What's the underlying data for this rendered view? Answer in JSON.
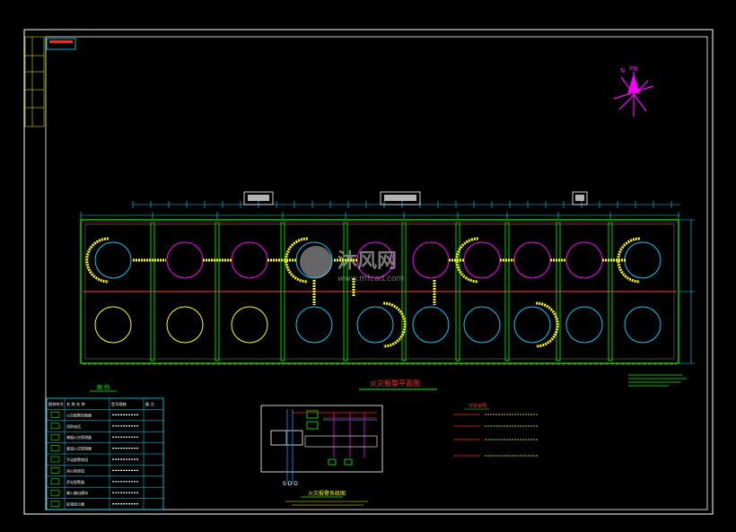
{
  "drawing": {
    "plan_title": "火灾报警平面图",
    "system_title": "火灾报警系统图",
    "system_label_sdd": "S D D",
    "north_label": "N",
    "pn_label": "PN",
    "watermark_cn": "沐风网",
    "watermark_url": "www.mfcad.com"
  },
  "legend": {
    "title": "图 例",
    "headers": [
      "图例符号",
      "名 称 名 称",
      "型号规格",
      "备 注"
    ],
    "rows": [
      {
        "name": "火灾报警控制器"
      },
      {
        "name": "消防电话"
      },
      {
        "name": "感烟火灾探测器"
      },
      {
        "name": "感温火灾探测器"
      },
      {
        "name": "手动报警按钮"
      },
      {
        "name": "消火栓按钮"
      },
      {
        "name": "声光报警器"
      },
      {
        "name": "输入输出模块"
      },
      {
        "name": "区域显示器"
      }
    ]
  },
  "cable_notes": {
    "title": "文字说明"
  },
  "colors": {
    "frame": "#ffffff",
    "wall": "#00ff00",
    "tank_cyan": "#00c8ff",
    "tank_magenta": "#ff00ff",
    "tank_yellow": "#ffff00",
    "cable_yellow": "#ffff00",
    "cable_red": "#ff2020",
    "dim_cyan": "#00e0ff",
    "title_red": "#ff3030"
  }
}
